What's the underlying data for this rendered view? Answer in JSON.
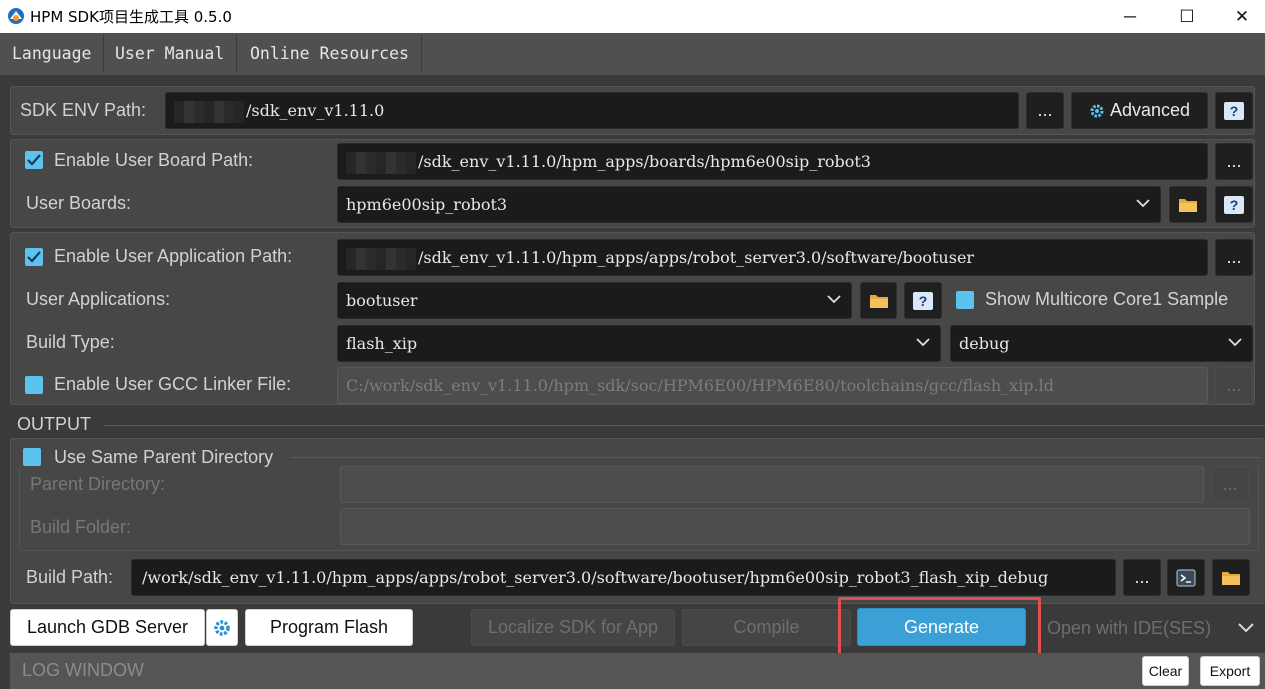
{
  "window": {
    "title": "HPM SDK项目生成工具 0.5.0",
    "minimize_glyph": "─",
    "maximize_glyph": "☐",
    "close_glyph": "✕"
  },
  "menu": [
    "Language",
    "User Manual",
    "Online Resources"
  ],
  "sdk": {
    "label": "SDK ENV Path:",
    "path": "/sdk_env_v1.11.0",
    "browse": "...",
    "advanced": "Advanced",
    "help": "?"
  },
  "board": {
    "enable_label": "Enable User Board Path:",
    "path": "/sdk_env_v1.11.0/hpm_apps/boards/hpm6e00sip_robot3",
    "browse": "...",
    "boards_label": "User Boards:",
    "selected": "hpm6e00sip_robot3",
    "help": "?"
  },
  "app": {
    "enable_label": "Enable User Application Path:",
    "path": "/sdk_env_v1.11.0/hpm_apps/apps/robot_server3.0/software/bootuser",
    "browse": "...",
    "apps_label": "User Applications:",
    "selected": "bootuser",
    "help": "?",
    "multicore_label": "Show Multicore Core1 Sample",
    "build_type_label": "Build Type:",
    "build_type": "flash_xip",
    "build_config": "debug",
    "linker_label": "Enable User GCC Linker File:",
    "linker_path": "C:/work/sdk_env_v1.11.0/hpm_sdk/soc/HPM6E00/HPM6E80/toolchains/gcc/flash_xip.ld",
    "linker_browse": "..."
  },
  "output": {
    "section": "OUTPUT",
    "same_parent_label": "Use Same Parent Directory",
    "parent_dir_label": "Parent Directory:",
    "parent_browse": "...",
    "build_folder_label": "Build Folder:",
    "build_path_label": "Build Path:",
    "build_path": "/work/sdk_env_v1.11.0/hpm_apps/apps/robot_server3.0/software/bootuser/hpm6e00sip_robot3_flash_xip_debug",
    "build_browse": "..."
  },
  "actions": {
    "launch_gdb": "Launch GDB Server",
    "program_flash": "Program Flash",
    "localize": "Localize SDK for App",
    "compile": "Compile",
    "generate": "Generate",
    "open_ide": "Open with IDE(SES)"
  },
  "log": {
    "title": "LOG WINDOW",
    "clear": "Clear",
    "export": "Export"
  },
  "colors": {
    "accent": "#3aa0d6",
    "checkbox": "#5cc3ee",
    "highlight": "#e05050"
  }
}
